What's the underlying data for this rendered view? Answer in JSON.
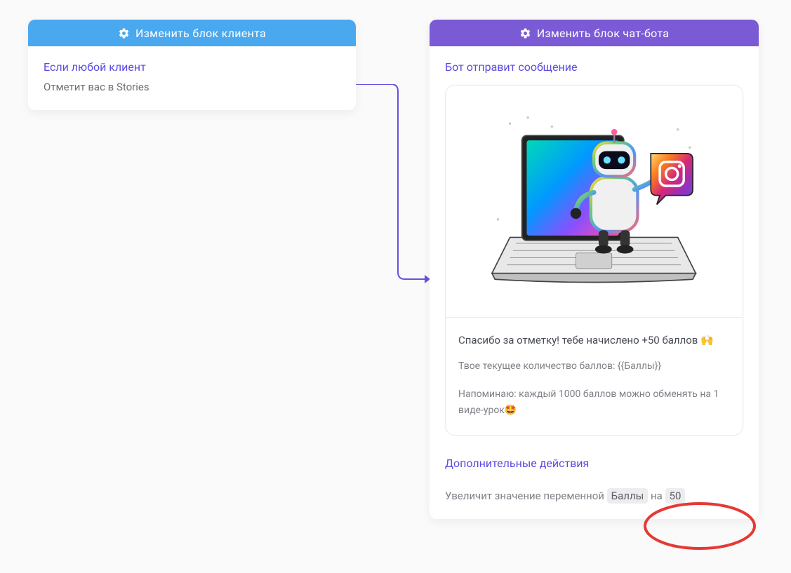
{
  "client_block": {
    "header": "Изменить блок клиента",
    "title": "Если любой клиент",
    "action": "Отметит вас в Stories"
  },
  "bot_block": {
    "header": "Изменить блок чат-бота",
    "title": "Бот отправит сообщение",
    "message": {
      "line1": "Спасибо за отметку! тебе начислено +50 баллов 🙌",
      "line2": "Твое текущее количество баллов: {{Баллы}}",
      "line3": "Напоминаю: каждый 1000 баллов можно обменять на 1 виде-урок🤩"
    },
    "extra": {
      "title": "Дополнительные действия",
      "prefix": "Увеличит значение переменной",
      "variable": "Баллы",
      "middle": "на",
      "value": "50"
    }
  }
}
